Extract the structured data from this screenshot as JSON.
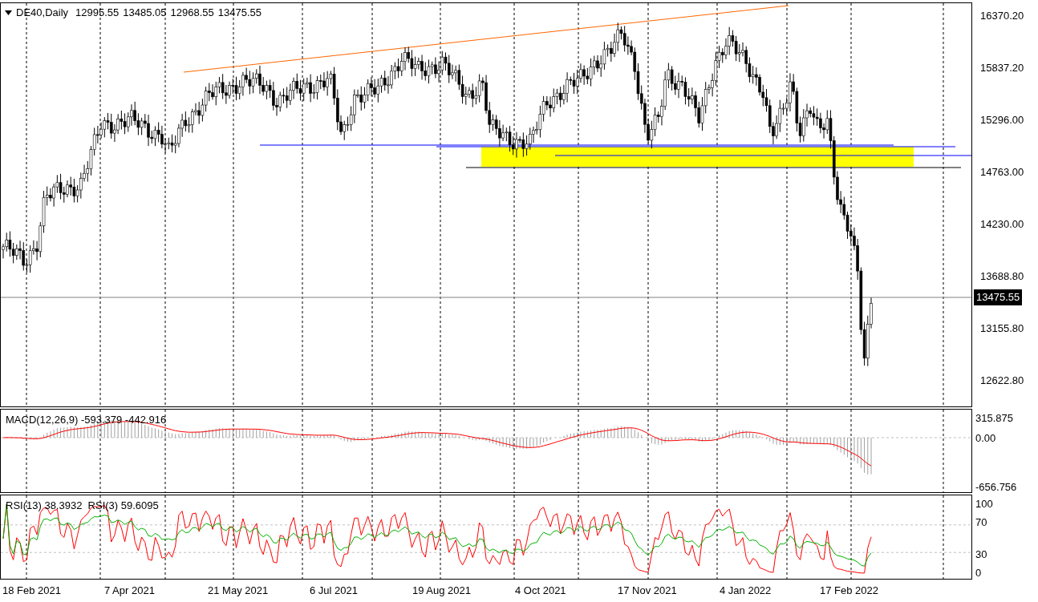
{
  "header": {
    "symbol": "DE40,Daily",
    "ohlc": [
      "12995.55",
      "13485.05",
      "12968.55",
      "13475.55"
    ]
  },
  "price_axis": {
    "ticks": [
      "16370.20",
      "15837.20",
      "15296.00",
      "14763.00",
      "14230.00",
      "13688.80",
      "13155.80",
      "12622.80"
    ],
    "current_price": "13475.55"
  },
  "macd": {
    "label": "MACD(12,26,9) -593.379 -442.916",
    "ticks": [
      "315.875",
      "0.00",
      "-656.756"
    ]
  },
  "rsi": {
    "label": "RSI(13) 38.3932  RSI(3) 59.6095",
    "ticks": [
      "100",
      "70",
      "30",
      "0"
    ]
  },
  "date_axis": [
    "18 Feb 2021",
    "7 Apr 2021",
    "21 May 2021",
    "6 Jul 2021",
    "19 Aug 2021",
    "4 Oct 2021",
    "17 Nov 2021",
    "4 Jan 2022",
    "17 Feb 2022"
  ]
}
